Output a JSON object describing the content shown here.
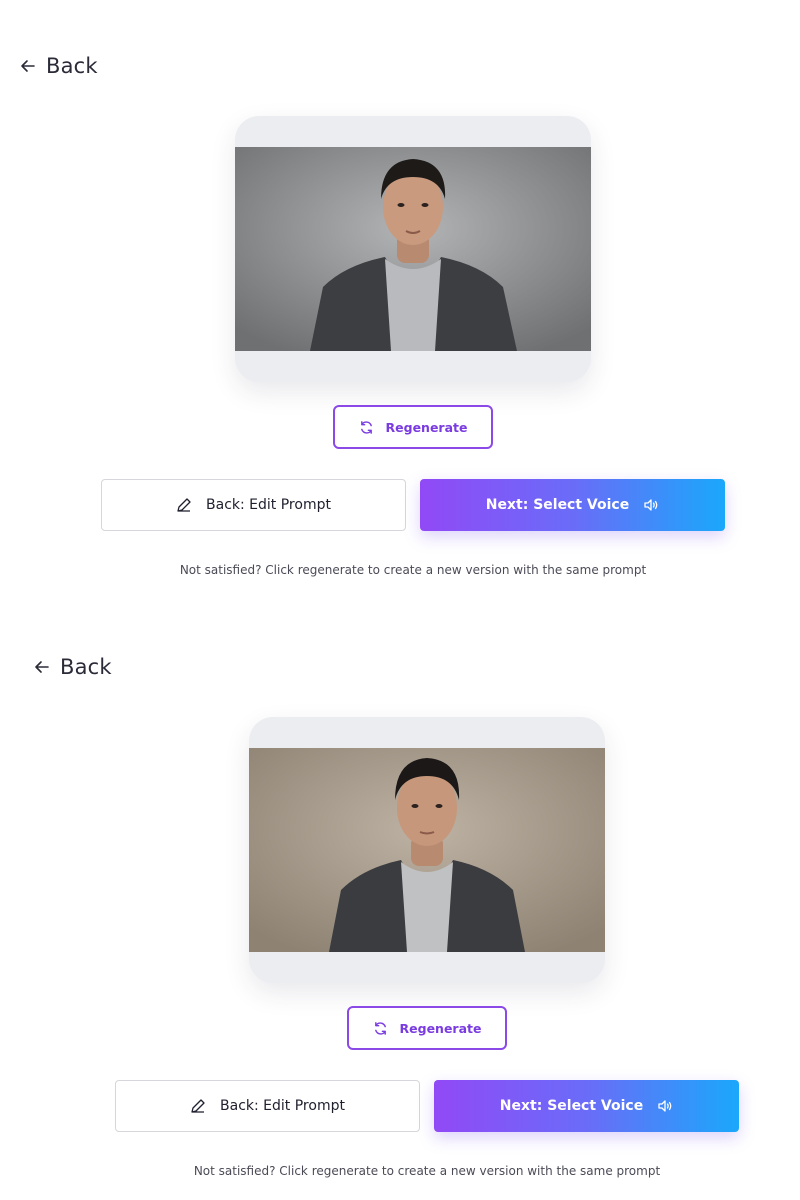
{
  "screens": [
    {
      "back_label": "Back",
      "regenerate_label": "Regenerate",
      "edit_prompt_label": "Back: Edit Prompt",
      "next_label": "Next: Select Voice",
      "hint": "Not satisfied? Click regenerate to create a new version with the same prompt",
      "photo_background": "#8f9092"
    },
    {
      "back_label": "Back",
      "regenerate_label": "Regenerate",
      "edit_prompt_label": "Back: Edit Prompt",
      "next_label": "Next: Select Voice",
      "hint": "Not satisfied? Click regenerate to create a new version with the same prompt",
      "photo_background": "#a4998b"
    }
  ],
  "colors": {
    "accent_purple": "#8b4ae8",
    "gradient_start": "#9149f6",
    "gradient_end": "#1aa8fb"
  },
  "icons": {
    "back": "arrow-left-icon",
    "regenerate": "refresh-icon",
    "edit": "pencil-icon",
    "voice": "speaker-icon"
  }
}
